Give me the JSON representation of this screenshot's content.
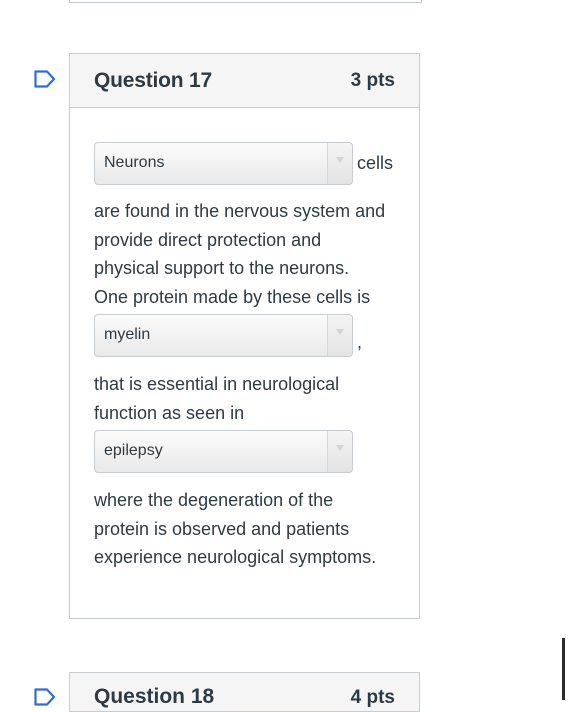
{
  "question17": {
    "title": "Question 17",
    "points": "3 pts",
    "dropdown1_value": "Neurons",
    "after_dropdown1": "cells",
    "paragraph1": [
      "are found in the nervous system and",
      "provide direct protection and",
      "physical support to the neurons.",
      "One protein made by these cells is"
    ],
    "dropdown2_value": "myelin",
    "after_dropdown2": ",",
    "paragraph2": [
      "that is essential in neurological",
      "function as seen in"
    ],
    "dropdown3_value": "epilepsy",
    "paragraph3": [
      "where the degeneration of the",
      "protein is observed and patients",
      "experience neurological symptoms."
    ]
  },
  "question18": {
    "title": "Question 18",
    "points": "4 pts"
  },
  "colors": {
    "flag": "#2d6ecf",
    "border": "#c7cdd1",
    "text": "#2d3b45"
  }
}
